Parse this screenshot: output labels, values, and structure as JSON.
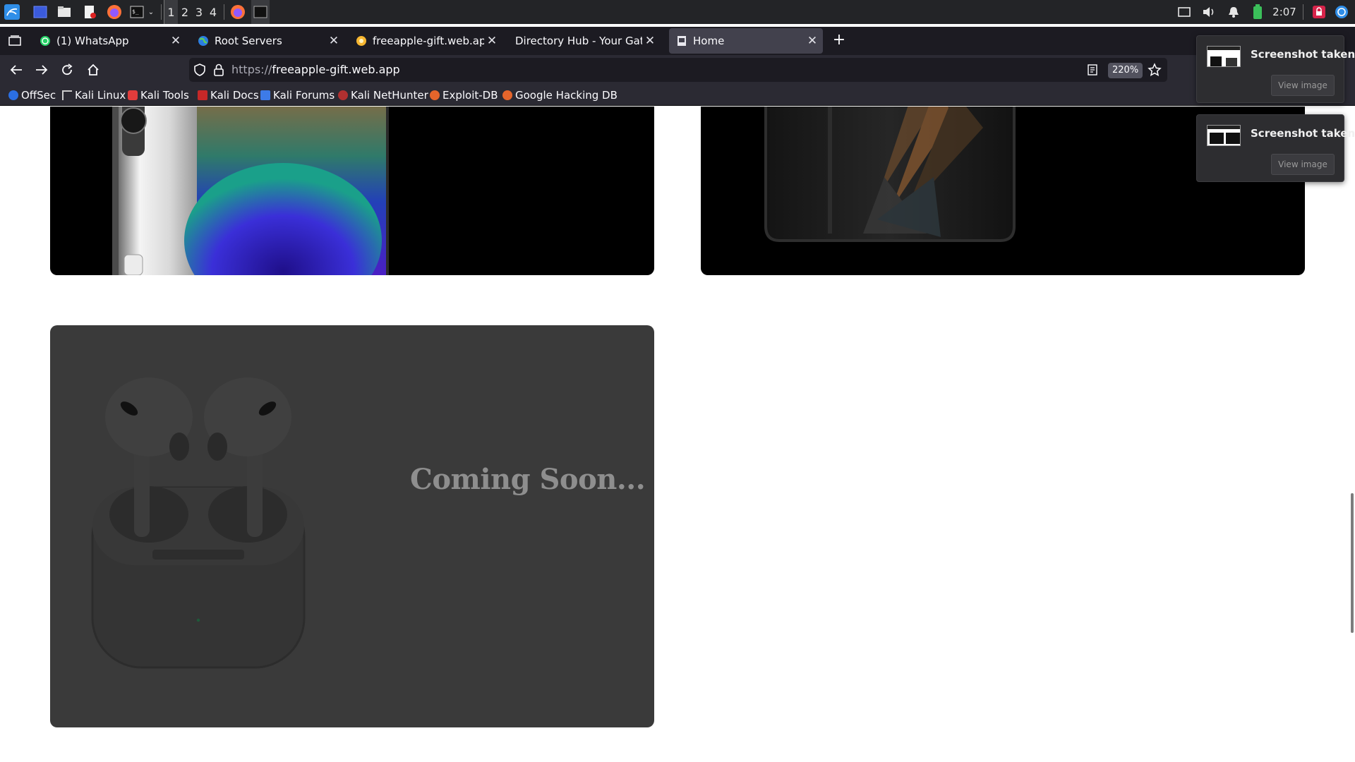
{
  "system_panel": {
    "workspaces": [
      "1",
      "2",
      "3",
      "4"
    ],
    "active_workspace": "1",
    "clock": "2:07"
  },
  "tabs": [
    {
      "label": "(1) WhatsApp",
      "icon": "whatsapp-icon"
    },
    {
      "label": "Root Servers",
      "icon": "globe-icon"
    },
    {
      "label": "freeapple-gift.web.app D",
      "icon": "site-favicon"
    },
    {
      "label": "Directory Hub - Your Gatewa",
      "icon": "none"
    },
    {
      "label": "Home",
      "icon": "page-icon",
      "active": true
    }
  ],
  "navbar": {
    "url_prefix": "https://",
    "url_host": "freeapple-gift.web.app",
    "zoom": "220%"
  },
  "bookmarks": [
    {
      "label": "OffSec",
      "icon": "offsec-icon"
    },
    {
      "label": "Kali Linux",
      "icon": "kali-icon"
    },
    {
      "label": "Kali Tools",
      "icon": "kali-tools-icon"
    },
    {
      "label": "Kali Docs",
      "icon": "kali-docs-icon"
    },
    {
      "label": "Kali Forums",
      "icon": "kali-forums-icon"
    },
    {
      "label": "Kali NetHunter",
      "icon": "nethunter-icon"
    },
    {
      "label": "Exploit-DB",
      "icon": "exploitdb-icon"
    },
    {
      "label": "Google Hacking DB",
      "icon": "ghdb-icon"
    }
  ],
  "page": {
    "coming_soon": "Coming Soon..."
  },
  "notifications": [
    {
      "title": "Screenshot taken",
      "action": "View image"
    },
    {
      "title": "Screenshot taken",
      "action": "View image"
    }
  ],
  "colors": {
    "panel_bg": "#232427",
    "tab_strip_bg": "#1c1b22",
    "toolbar_bg": "#2b2a33",
    "card_bg": "#3a3a3a",
    "coming_soon_text": "#8e8e8e"
  }
}
